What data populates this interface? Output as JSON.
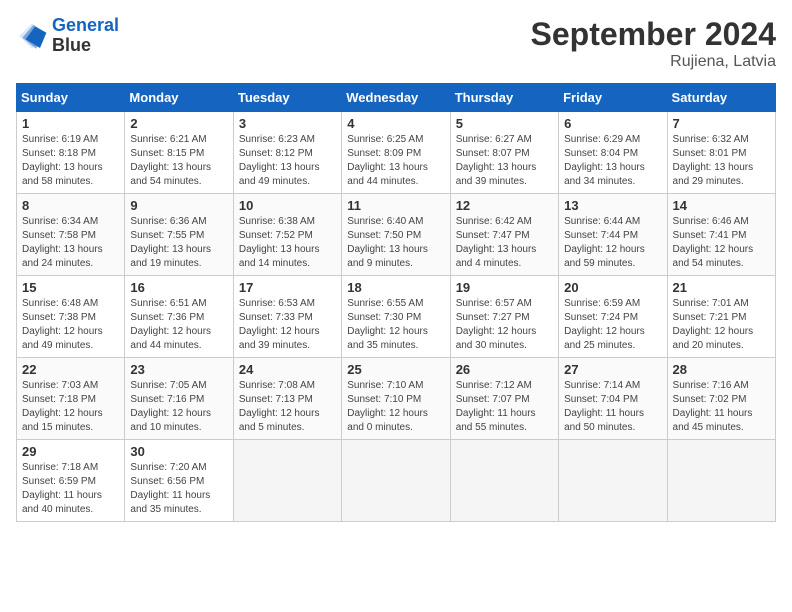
{
  "title": "September 2024",
  "subtitle": "Rujiena, Latvia",
  "logo": {
    "line1": "General",
    "line2": "Blue"
  },
  "days_of_week": [
    "Sunday",
    "Monday",
    "Tuesday",
    "Wednesday",
    "Thursday",
    "Friday",
    "Saturday"
  ],
  "weeks": [
    [
      {
        "num": "1",
        "sunrise": "6:19 AM",
        "sunset": "8:18 PM",
        "daylight": "13 hours and 58 minutes."
      },
      {
        "num": "2",
        "sunrise": "6:21 AM",
        "sunset": "8:15 PM",
        "daylight": "13 hours and 54 minutes."
      },
      {
        "num": "3",
        "sunrise": "6:23 AM",
        "sunset": "8:12 PM",
        "daylight": "13 hours and 49 minutes."
      },
      {
        "num": "4",
        "sunrise": "6:25 AM",
        "sunset": "8:09 PM",
        "daylight": "13 hours and 44 minutes."
      },
      {
        "num": "5",
        "sunrise": "6:27 AM",
        "sunset": "8:07 PM",
        "daylight": "13 hours and 39 minutes."
      },
      {
        "num": "6",
        "sunrise": "6:29 AM",
        "sunset": "8:04 PM",
        "daylight": "13 hours and 34 minutes."
      },
      {
        "num": "7",
        "sunrise": "6:32 AM",
        "sunset": "8:01 PM",
        "daylight": "13 hours and 29 minutes."
      }
    ],
    [
      {
        "num": "8",
        "sunrise": "6:34 AM",
        "sunset": "7:58 PM",
        "daylight": "13 hours and 24 minutes."
      },
      {
        "num": "9",
        "sunrise": "6:36 AM",
        "sunset": "7:55 PM",
        "daylight": "13 hours and 19 minutes."
      },
      {
        "num": "10",
        "sunrise": "6:38 AM",
        "sunset": "7:52 PM",
        "daylight": "13 hours and 14 minutes."
      },
      {
        "num": "11",
        "sunrise": "6:40 AM",
        "sunset": "7:50 PM",
        "daylight": "13 hours and 9 minutes."
      },
      {
        "num": "12",
        "sunrise": "6:42 AM",
        "sunset": "7:47 PM",
        "daylight": "13 hours and 4 minutes."
      },
      {
        "num": "13",
        "sunrise": "6:44 AM",
        "sunset": "7:44 PM",
        "daylight": "12 hours and 59 minutes."
      },
      {
        "num": "14",
        "sunrise": "6:46 AM",
        "sunset": "7:41 PM",
        "daylight": "12 hours and 54 minutes."
      }
    ],
    [
      {
        "num": "15",
        "sunrise": "6:48 AM",
        "sunset": "7:38 PM",
        "daylight": "12 hours and 49 minutes."
      },
      {
        "num": "16",
        "sunrise": "6:51 AM",
        "sunset": "7:36 PM",
        "daylight": "12 hours and 44 minutes."
      },
      {
        "num": "17",
        "sunrise": "6:53 AM",
        "sunset": "7:33 PM",
        "daylight": "12 hours and 39 minutes."
      },
      {
        "num": "18",
        "sunrise": "6:55 AM",
        "sunset": "7:30 PM",
        "daylight": "12 hours and 35 minutes."
      },
      {
        "num": "19",
        "sunrise": "6:57 AM",
        "sunset": "7:27 PM",
        "daylight": "12 hours and 30 minutes."
      },
      {
        "num": "20",
        "sunrise": "6:59 AM",
        "sunset": "7:24 PM",
        "daylight": "12 hours and 25 minutes."
      },
      {
        "num": "21",
        "sunrise": "7:01 AM",
        "sunset": "7:21 PM",
        "daylight": "12 hours and 20 minutes."
      }
    ],
    [
      {
        "num": "22",
        "sunrise": "7:03 AM",
        "sunset": "7:18 PM",
        "daylight": "12 hours and 15 minutes."
      },
      {
        "num": "23",
        "sunrise": "7:05 AM",
        "sunset": "7:16 PM",
        "daylight": "12 hours and 10 minutes."
      },
      {
        "num": "24",
        "sunrise": "7:08 AM",
        "sunset": "7:13 PM",
        "daylight": "12 hours and 5 minutes."
      },
      {
        "num": "25",
        "sunrise": "7:10 AM",
        "sunset": "7:10 PM",
        "daylight": "12 hours and 0 minutes."
      },
      {
        "num": "26",
        "sunrise": "7:12 AM",
        "sunset": "7:07 PM",
        "daylight": "11 hours and 55 minutes."
      },
      {
        "num": "27",
        "sunrise": "7:14 AM",
        "sunset": "7:04 PM",
        "daylight": "11 hours and 50 minutes."
      },
      {
        "num": "28",
        "sunrise": "7:16 AM",
        "sunset": "7:02 PM",
        "daylight": "11 hours and 45 minutes."
      }
    ],
    [
      {
        "num": "29",
        "sunrise": "7:18 AM",
        "sunset": "6:59 PM",
        "daylight": "11 hours and 40 minutes."
      },
      {
        "num": "30",
        "sunrise": "7:20 AM",
        "sunset": "6:56 PM",
        "daylight": "11 hours and 35 minutes."
      },
      null,
      null,
      null,
      null,
      null
    ]
  ]
}
